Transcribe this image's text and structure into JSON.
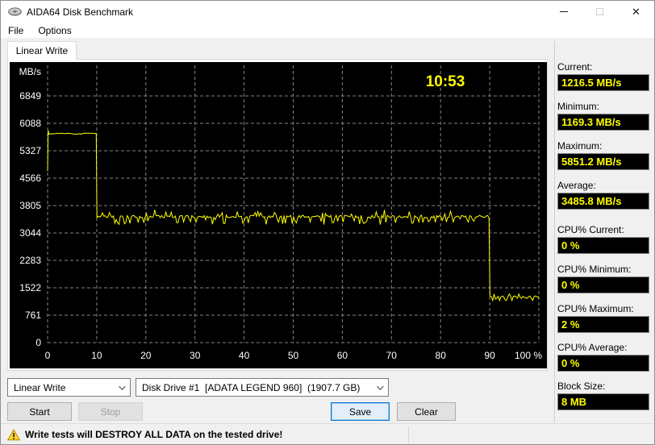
{
  "window": {
    "title": "AIDA64 Disk Benchmark",
    "close_glyph": "✕"
  },
  "menu": {
    "items": [
      {
        "label": "File"
      },
      {
        "label": "Options"
      }
    ]
  },
  "tab": {
    "label": "Linear Write"
  },
  "chart_data": {
    "type": "line",
    "title": "Linear Write benchmark trace",
    "ylabel": "MB/s",
    "clock": "10:53",
    "y_ticks": [
      6849,
      6088,
      5327,
      4566,
      3805,
      3044,
      2283,
      1522,
      761,
      0
    ],
    "x_tick_labels": [
      "0",
      "10",
      "20",
      "30",
      "40",
      "50",
      "60",
      "70",
      "80",
      "90",
      "100 %"
    ],
    "xlim": [
      0,
      100
    ],
    "ylim": [
      0,
      7610
    ],
    "grid": true,
    "line_color": "#ffff00",
    "background": "#000000",
    "grid_color": "#848484",
    "segments": [
      {
        "type": "spike",
        "x": 0,
        "values": [
          4760,
          5890
        ]
      },
      {
        "type": "flat",
        "from": 0.3,
        "to": 9.9,
        "value": 5800,
        "jitter": 30
      },
      {
        "type": "noise",
        "from": 10,
        "to": 90,
        "base": 3500,
        "min": 3280,
        "max": 3690
      },
      {
        "type": "noise",
        "from": 90,
        "to": 100,
        "base": 1262,
        "min": 1170,
        "max": 1350
      }
    ],
    "end_value": 1216.5
  },
  "stats": [
    {
      "label": "Current:",
      "value": "1216.5 MB/s"
    },
    {
      "label": "Minimum:",
      "value": "1169.3 MB/s"
    },
    {
      "label": "Maximum:",
      "value": "5851.2 MB/s"
    },
    {
      "label": "Average:",
      "value": "3485.8 MB/s"
    },
    {
      "label": "CPU% Current:",
      "value": "0 %"
    },
    {
      "label": "CPU% Minimum:",
      "value": "0 %"
    },
    {
      "label": "CPU% Maximum:",
      "value": "2 %"
    },
    {
      "label": "CPU% Average:",
      "value": "0 %"
    },
    {
      "label": "Block Size:",
      "value": "8 MB"
    }
  ],
  "controls": {
    "test_select": {
      "value": "Linear Write"
    },
    "drive_select": {
      "value": "Disk Drive #1  [ADATA LEGEND 960]  (1907.7 GB)"
    },
    "start_label": "Start",
    "stop_label": "Stop",
    "save_label": "Save",
    "clear_label": "Clear"
  },
  "status": {
    "warning": "Write tests will DESTROY ALL DATA on the tested drive!"
  },
  "colors": {
    "accent": "#0078d7",
    "trace": "#ffff00",
    "value_text": "#ffff00",
    "chart_bg": "#000000"
  }
}
